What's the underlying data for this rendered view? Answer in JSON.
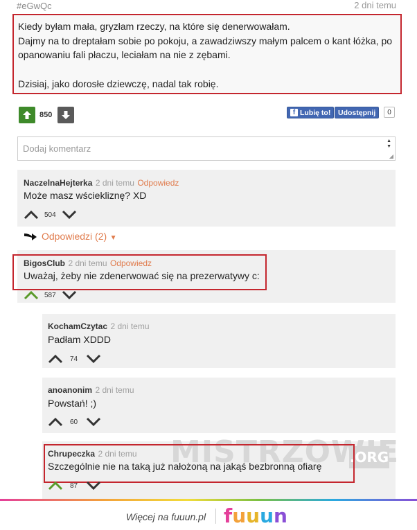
{
  "post": {
    "id": "#eGwQc",
    "date": "2 dni temu",
    "lines": [
      "Kiedy byłam mała, gryzłam rzeczy, na które się denerwowałam.",
      "Dajmy na to dreptałam sobie po pokoju, a zawadziwszy małym palcem o kant łóżka, po",
      "opanowaniu fali płaczu, leciałam na nie z zębami.",
      "Dzisiaj, jako dorosłe dziewczę, nadal tak robię."
    ],
    "score": "850",
    "like_label": "Lubię to!",
    "share_label": "Udostępnij",
    "share_count": "0"
  },
  "comment_box": {
    "placeholder": "Dodaj komentarz"
  },
  "comments": [
    {
      "author": "NaczelnaHejterka",
      "date": "2 dni temu",
      "reply": "Odpowiedz",
      "text": "Może masz wściekliznę? XD",
      "score": "504"
    },
    {
      "author": "BigosClub",
      "date": "2 dni temu",
      "reply": "Odpowiedz",
      "text": "Uważaj, żeby nie zdenerwować się na prezerwatywy c:",
      "score": "587"
    }
  ],
  "replies_toggle": "Odpowiedzi (2)",
  "replies": [
    {
      "author": "KochamCzytac",
      "date": "2 dni temu",
      "text": "Padłam XDDD",
      "score": "74"
    },
    {
      "author": "anoanonim",
      "date": "2 dni temu",
      "text": "Powstań! ;)",
      "score": "60"
    },
    {
      "author": "Chrupeczka",
      "date": "2 dni temu",
      "text": "Szczególnie nie na taką już nałożoną na jakąś bezbronną ofiarę",
      "score": "87"
    }
  ],
  "watermark": {
    "name": "MISTRZOWIE",
    "tld": ".ORG"
  },
  "footer": {
    "text": "Więcej na fuuun.pl",
    "logo": [
      "f",
      "u",
      "u",
      "u",
      "n"
    ]
  },
  "colors": {
    "accent": "#e07b4c",
    "highlight": "#c4262e",
    "upvote": "#3e8a2a",
    "facebook": "#4267b2",
    "logo": [
      "#e43f9a",
      "#f3a23a",
      "#f2c43a",
      "#2aa9e0",
      "#8a4fd6"
    ]
  }
}
